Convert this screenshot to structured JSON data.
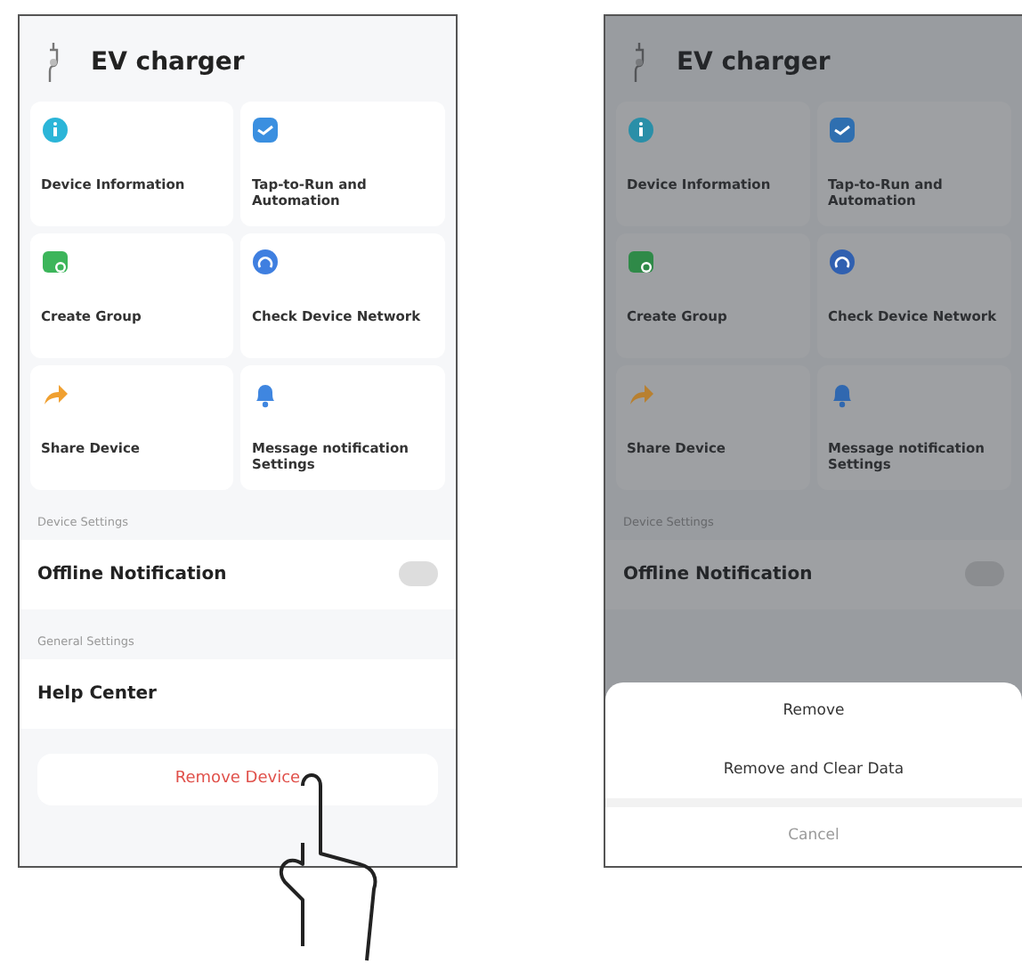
{
  "screens": [
    {
      "title": "EV charger",
      "tiles": [
        {
          "label": "Device Information",
          "kind": "info",
          "color": "#2bb5d8"
        },
        {
          "label": "Tap-to-Run and Automation",
          "kind": "automation",
          "color": "#3a8fe0"
        },
        {
          "label": "Create Group",
          "kind": "group",
          "color": "#3cb55a"
        },
        {
          "label": "Check Device Network",
          "kind": "network",
          "color": "#3f7fe0"
        },
        {
          "label": "Share Device",
          "kind": "share",
          "color": "#f0a030"
        },
        {
          "label": "Message notification Settings",
          "kind": "bell",
          "color": "#3f86e0"
        }
      ],
      "sections": [
        {
          "label": "Device Settings",
          "items": [
            {
              "label": "Offline Notification",
              "kind": "toggle",
              "on": false
            }
          ]
        },
        {
          "label": "General Settings",
          "items": [
            {
              "label": "Help Center",
              "kind": "link"
            }
          ]
        }
      ],
      "remove_button": "Remove Device",
      "pointer": true
    },
    {
      "title": "EV charger",
      "tiles": [
        {
          "label": "Device Information",
          "kind": "info",
          "color": "#2a8fa8"
        },
        {
          "label": "Tap-to-Run and Automation",
          "kind": "automation",
          "color": "#2f6fb0"
        },
        {
          "label": "Create Group",
          "kind": "group",
          "color": "#2f8a48"
        },
        {
          "label": "Check Device Network",
          "kind": "network",
          "color": "#3060b0"
        },
        {
          "label": "Share Device",
          "kind": "share",
          "color": "#b88030"
        },
        {
          "label": "Message notification Settings",
          "kind": "bell",
          "color": "#3068b0"
        }
      ],
      "sections": [
        {
          "label": "Device Settings",
          "items": [
            {
              "label": "Offline Notification",
              "kind": "toggle",
              "on": false
            }
          ]
        }
      ],
      "action_sheet": [
        {
          "label": "Remove",
          "kind": "option"
        },
        {
          "label": "Remove and Clear Data",
          "kind": "option"
        },
        {
          "label": "Cancel",
          "kind": "cancel"
        }
      ]
    }
  ]
}
